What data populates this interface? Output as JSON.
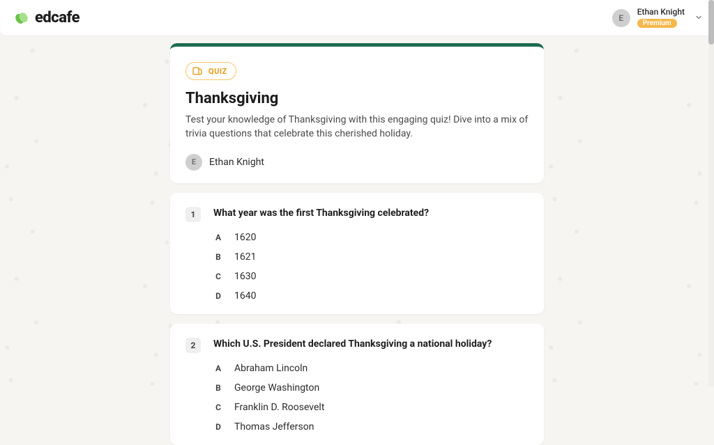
{
  "brand": {
    "name": "edcafe"
  },
  "header": {
    "user_initial": "E",
    "user_name": "Ethan Knight",
    "tier_label": "Premium"
  },
  "quiz": {
    "chip_label": "QUIZ",
    "title": "Thanksgiving",
    "description": "Test your knowledge of Thanksgiving with this engaging quiz! Dive into a mix of trivia questions that celebrate this cherished holiday.",
    "author_initial": "E",
    "author_name": "Ethan Knight"
  },
  "questions": [
    {
      "number": "1",
      "text": "What year was the first Thanksgiving celebrated?",
      "options": [
        {
          "letter": "A",
          "text": "1620"
        },
        {
          "letter": "B",
          "text": "1621"
        },
        {
          "letter": "C",
          "text": "1630"
        },
        {
          "letter": "D",
          "text": "1640"
        }
      ]
    },
    {
      "number": "2",
      "text": "Which U.S. President declared Thanksgiving a national holiday?",
      "options": [
        {
          "letter": "A",
          "text": "Abraham Lincoln"
        },
        {
          "letter": "B",
          "text": "George Washington"
        },
        {
          "letter": "C",
          "text": "Franklin D. Roosevelt"
        },
        {
          "letter": "D",
          "text": "Thomas Jefferson"
        }
      ]
    }
  ]
}
